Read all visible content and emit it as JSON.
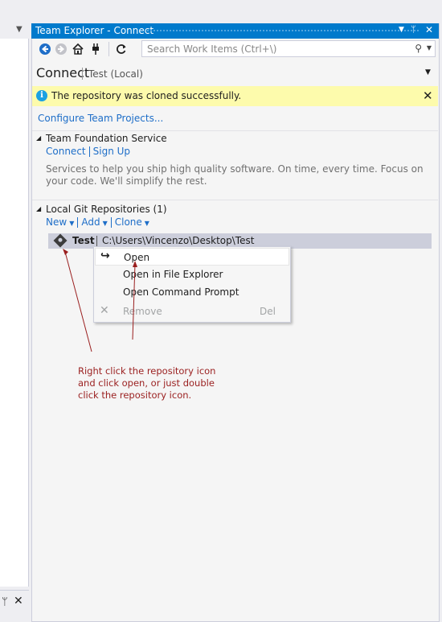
{
  "window": {
    "title": "Team Explorer - Connect"
  },
  "toolbar": {
    "search_placeholder": "Search Work Items (Ctrl+\\)",
    "icons": [
      "back-icon",
      "forward-icon",
      "home-icon",
      "connect-icon",
      "refresh-icon",
      "search-icon"
    ]
  },
  "header": {
    "title": "Connect",
    "subtitle": "Test (Local)"
  },
  "info_bar": {
    "message": "The repository was cloned successfully.",
    "color": "#fdfbac"
  },
  "configure_link": "Configure Team Projects...",
  "tfs_section": {
    "title": "Team Foundation Service",
    "links": [
      "Connect",
      "Sign Up"
    ],
    "description": "Services to help you ship high quality software. On time, every time. Focus on your code. We'll simplify the rest."
  },
  "git_section": {
    "title": "Local Git Repositories (1)",
    "actions": [
      "New",
      "Add",
      "Clone"
    ],
    "repositories": [
      {
        "name": "Test",
        "path": "C:\\Users\\Vincenzo\\Desktop\\Test"
      }
    ]
  },
  "context_menu": {
    "items": [
      {
        "label": "Open",
        "icon": "open-arrow-icon",
        "enabled": true,
        "highlighted": true
      },
      {
        "label": "Open in File Explorer",
        "enabled": true
      },
      {
        "label": "Open Command Prompt",
        "enabled": true
      },
      {
        "label": "Remove",
        "icon": "remove-x-icon",
        "enabled": false,
        "shortcut": "Del"
      }
    ]
  },
  "annotation": {
    "text": "Right click the repository icon and click open, or just double click the repository icon.",
    "color": "#9a1f1f"
  },
  "colors": {
    "accent": "#007acc",
    "link": "#1e6ec8",
    "selection": "#cccedb"
  }
}
